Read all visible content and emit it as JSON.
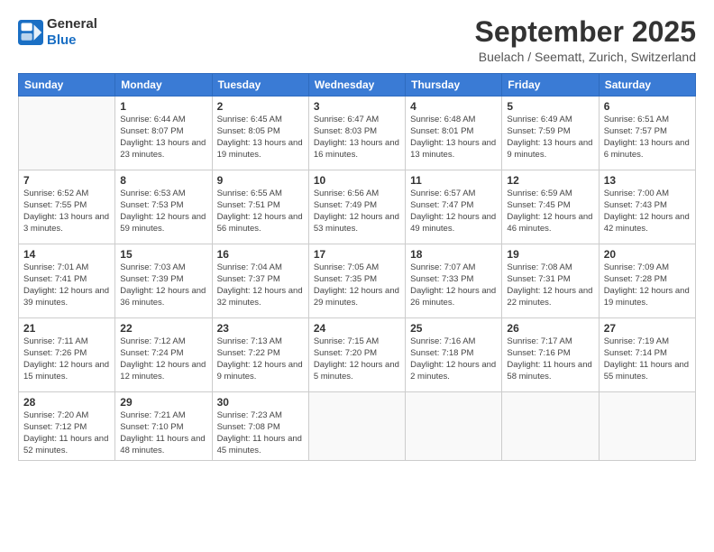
{
  "logo": {
    "line1": "General",
    "line2": "Blue"
  },
  "title": "September 2025",
  "subtitle": "Buelach / Seematt, Zurich, Switzerland",
  "weekdays": [
    "Sunday",
    "Monday",
    "Tuesday",
    "Wednesday",
    "Thursday",
    "Friday",
    "Saturday"
  ],
  "weeks": [
    [
      {
        "day": "",
        "info": ""
      },
      {
        "day": "1",
        "info": "Sunrise: 6:44 AM\nSunset: 8:07 PM\nDaylight: 13 hours\nand 23 minutes."
      },
      {
        "day": "2",
        "info": "Sunrise: 6:45 AM\nSunset: 8:05 PM\nDaylight: 13 hours\nand 19 minutes."
      },
      {
        "day": "3",
        "info": "Sunrise: 6:47 AM\nSunset: 8:03 PM\nDaylight: 13 hours\nand 16 minutes."
      },
      {
        "day": "4",
        "info": "Sunrise: 6:48 AM\nSunset: 8:01 PM\nDaylight: 13 hours\nand 13 minutes."
      },
      {
        "day": "5",
        "info": "Sunrise: 6:49 AM\nSunset: 7:59 PM\nDaylight: 13 hours\nand 9 minutes."
      },
      {
        "day": "6",
        "info": "Sunrise: 6:51 AM\nSunset: 7:57 PM\nDaylight: 13 hours\nand 6 minutes."
      }
    ],
    [
      {
        "day": "7",
        "info": "Sunrise: 6:52 AM\nSunset: 7:55 PM\nDaylight: 13 hours\nand 3 minutes."
      },
      {
        "day": "8",
        "info": "Sunrise: 6:53 AM\nSunset: 7:53 PM\nDaylight: 12 hours\nand 59 minutes."
      },
      {
        "day": "9",
        "info": "Sunrise: 6:55 AM\nSunset: 7:51 PM\nDaylight: 12 hours\nand 56 minutes."
      },
      {
        "day": "10",
        "info": "Sunrise: 6:56 AM\nSunset: 7:49 PM\nDaylight: 12 hours\nand 53 minutes."
      },
      {
        "day": "11",
        "info": "Sunrise: 6:57 AM\nSunset: 7:47 PM\nDaylight: 12 hours\nand 49 minutes."
      },
      {
        "day": "12",
        "info": "Sunrise: 6:59 AM\nSunset: 7:45 PM\nDaylight: 12 hours\nand 46 minutes."
      },
      {
        "day": "13",
        "info": "Sunrise: 7:00 AM\nSunset: 7:43 PM\nDaylight: 12 hours\nand 42 minutes."
      }
    ],
    [
      {
        "day": "14",
        "info": "Sunrise: 7:01 AM\nSunset: 7:41 PM\nDaylight: 12 hours\nand 39 minutes."
      },
      {
        "day": "15",
        "info": "Sunrise: 7:03 AM\nSunset: 7:39 PM\nDaylight: 12 hours\nand 36 minutes."
      },
      {
        "day": "16",
        "info": "Sunrise: 7:04 AM\nSunset: 7:37 PM\nDaylight: 12 hours\nand 32 minutes."
      },
      {
        "day": "17",
        "info": "Sunrise: 7:05 AM\nSunset: 7:35 PM\nDaylight: 12 hours\nand 29 minutes."
      },
      {
        "day": "18",
        "info": "Sunrise: 7:07 AM\nSunset: 7:33 PM\nDaylight: 12 hours\nand 26 minutes."
      },
      {
        "day": "19",
        "info": "Sunrise: 7:08 AM\nSunset: 7:31 PM\nDaylight: 12 hours\nand 22 minutes."
      },
      {
        "day": "20",
        "info": "Sunrise: 7:09 AM\nSunset: 7:28 PM\nDaylight: 12 hours\nand 19 minutes."
      }
    ],
    [
      {
        "day": "21",
        "info": "Sunrise: 7:11 AM\nSunset: 7:26 PM\nDaylight: 12 hours\nand 15 minutes."
      },
      {
        "day": "22",
        "info": "Sunrise: 7:12 AM\nSunset: 7:24 PM\nDaylight: 12 hours\nand 12 minutes."
      },
      {
        "day": "23",
        "info": "Sunrise: 7:13 AM\nSunset: 7:22 PM\nDaylight: 12 hours\nand 9 minutes."
      },
      {
        "day": "24",
        "info": "Sunrise: 7:15 AM\nSunset: 7:20 PM\nDaylight: 12 hours\nand 5 minutes."
      },
      {
        "day": "25",
        "info": "Sunrise: 7:16 AM\nSunset: 7:18 PM\nDaylight: 12 hours\nand 2 minutes."
      },
      {
        "day": "26",
        "info": "Sunrise: 7:17 AM\nSunset: 7:16 PM\nDaylight: 11 hours\nand 58 minutes."
      },
      {
        "day": "27",
        "info": "Sunrise: 7:19 AM\nSunset: 7:14 PM\nDaylight: 11 hours\nand 55 minutes."
      }
    ],
    [
      {
        "day": "28",
        "info": "Sunrise: 7:20 AM\nSunset: 7:12 PM\nDaylight: 11 hours\nand 52 minutes."
      },
      {
        "day": "29",
        "info": "Sunrise: 7:21 AM\nSunset: 7:10 PM\nDaylight: 11 hours\nand 48 minutes."
      },
      {
        "day": "30",
        "info": "Sunrise: 7:23 AM\nSunset: 7:08 PM\nDaylight: 11 hours\nand 45 minutes."
      },
      {
        "day": "",
        "info": ""
      },
      {
        "day": "",
        "info": ""
      },
      {
        "day": "",
        "info": ""
      },
      {
        "day": "",
        "info": ""
      }
    ]
  ]
}
